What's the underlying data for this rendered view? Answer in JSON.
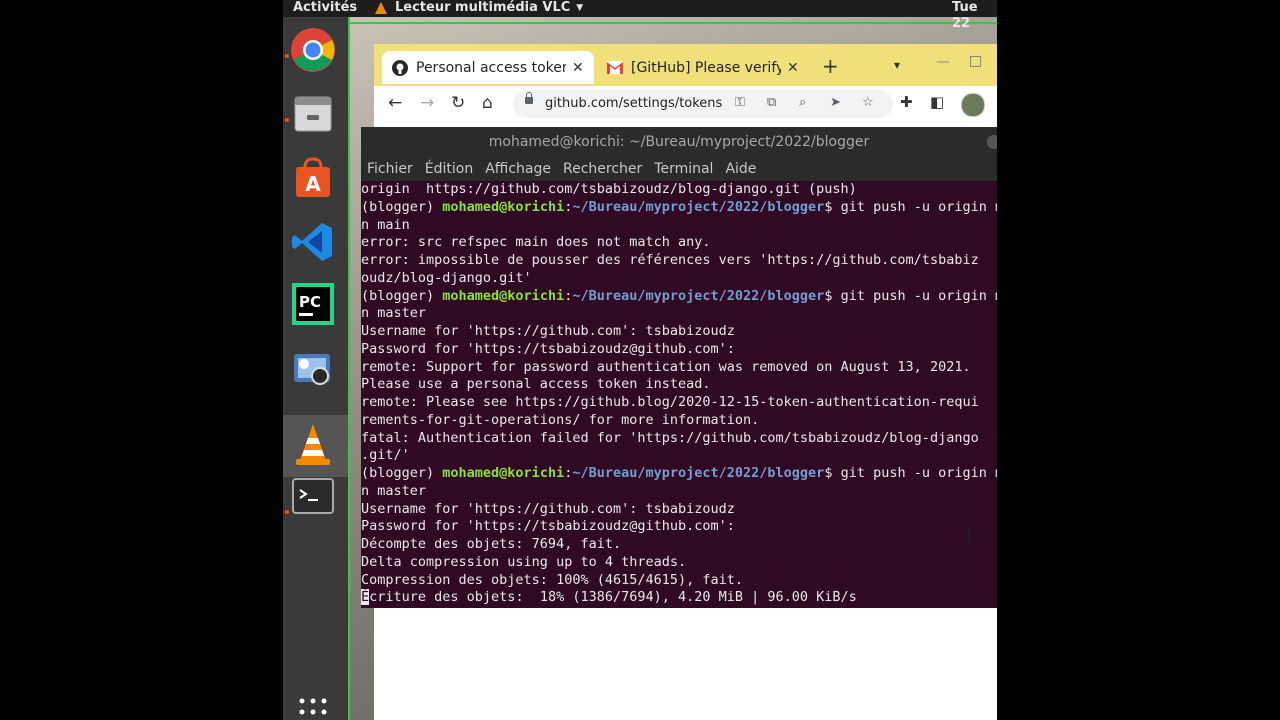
{
  "topbar": {
    "activities": "Activités",
    "app_name": "Lecteur multimédia VLC",
    "clock": "Tue 22"
  },
  "dock": {
    "items": [
      "chrome-icon",
      "files-icon",
      "software-center-icon",
      "vscode-icon",
      "pycharm-icon",
      "video-editor-icon",
      "vlc-icon",
      "terminal-icon",
      "apps-grid-icon"
    ],
    "accent": "#e95420"
  },
  "browser": {
    "tabs": [
      {
        "title": "Personal access tokens"
      },
      {
        "title": "[GitHub] Please verify your device"
      }
    ],
    "url": "github.com/settings/tokens",
    "tab_strip_color": "#f0e07a"
  },
  "terminal": {
    "title": "mohamed@korichi: ~/Bureau/myproject/2022/blogger",
    "menu": [
      "Fichier",
      "Édition",
      "Affichage",
      "Rechercher",
      "Terminal",
      "Aide"
    ],
    "prompt": {
      "env": "(blogger) ",
      "user": "mohamed@korichi",
      "sep": ":",
      "path": "~/Bureau/myproject/2022/blogger",
      "dollar": "$ "
    },
    "lines": [
      {
        "text": "origin  https://github.com/tsbabizoudz/blog-django.git (push)"
      },
      {
        "prompt": true,
        "cmd": "git push -u origin main"
      },
      {
        "text": "n main"
      },
      {
        "text": "error: src refspec main does not match any."
      },
      {
        "text": "error: impossible de pousser des références vers 'https://github.com/tsbabiz"
      },
      {
        "text": "oudz/blog-django.git'"
      },
      {
        "prompt": true,
        "cmd": "git push -u origin master"
      },
      {
        "text": "n master"
      },
      {
        "text": "Username for 'https://github.com': tsbabizoudz"
      },
      {
        "text": "Password for 'https://tsbabizoudz@github.com':"
      },
      {
        "text": "remote: Support for password authentication was removed on August 13, 2021."
      },
      {
        "text": "Please use a personal access token instead."
      },
      {
        "text": "remote: Please see https://github.blog/2020-12-15-token-authentication-requi"
      },
      {
        "text": "rements-for-git-operations/ for more information."
      },
      {
        "text": "fatal: Authentication failed for 'https://github.com/tsbabizoudz/blog-django"
      },
      {
        "text": ".git/'"
      },
      {
        "prompt": true,
        "cmd": "git push -u origin master"
      },
      {
        "text": "n master"
      },
      {
        "text": "Username for 'https://github.com': tsbabizoudz"
      },
      {
        "text": "Password for 'https://tsbabizoudz@github.com':"
      },
      {
        "text": "Décompte des objets: 7694, fait."
      },
      {
        "text": "Delta compression using up to 4 threads."
      },
      {
        "text": "Compression des objets: 100% (4615/4615), fait."
      },
      {
        "cursor": "É",
        "text": "criture des objets:  18% (1386/7694), 4.20 MiB | 96.00 KiB/s"
      }
    ],
    "bg_color": "#300a24",
    "user_color": "#8ae234",
    "path_color": "#729fcf"
  }
}
